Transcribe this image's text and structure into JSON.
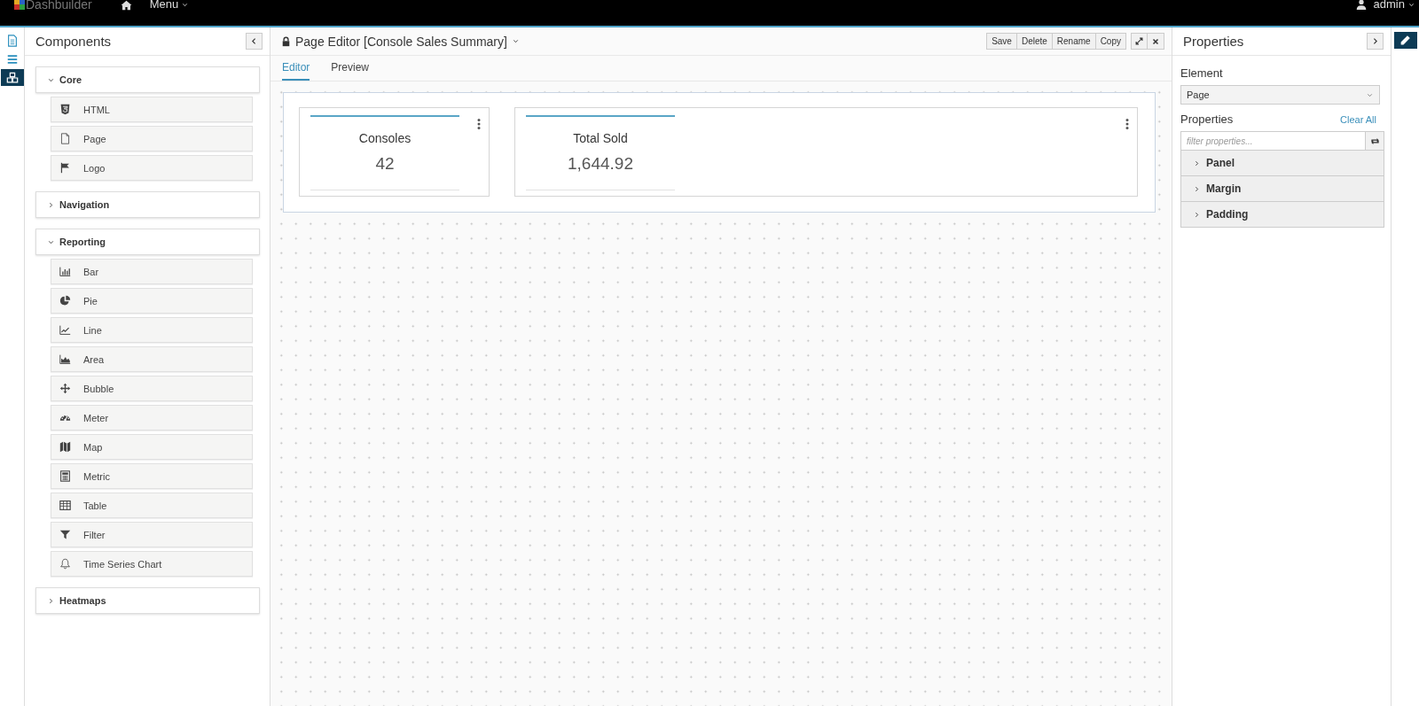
{
  "topbar": {
    "brand": "Dashbuilder",
    "menu": "Menu",
    "user": "admin"
  },
  "sidebar_icons": [
    {
      "selected": false
    },
    {
      "selected": false
    },
    {
      "selected": true
    }
  ],
  "components": {
    "title": "Components",
    "groups": [
      {
        "label": "Core",
        "expanded": true,
        "items": [
          "HTML",
          "Page",
          "Logo"
        ]
      },
      {
        "label": "Navigation",
        "expanded": false
      },
      {
        "label": "Reporting",
        "expanded": true,
        "items": [
          "Bar",
          "Pie",
          "Line",
          "Area",
          "Bubble",
          "Meter",
          "Map",
          "Metric",
          "Table",
          "Filter",
          "Time Series Chart"
        ]
      },
      {
        "label": "Heatmaps",
        "expanded": false
      }
    ]
  },
  "editor": {
    "title": "Page Editor [Console Sales Summary]",
    "buttons": [
      "Save",
      "Delete",
      "Rename",
      "Copy"
    ],
    "tabs": [
      {
        "label": "Editor",
        "selected": true
      },
      {
        "label": "Preview",
        "selected": false
      }
    ],
    "metrics": [
      {
        "title": "Consoles",
        "value": "42"
      },
      {
        "title": "Total Sold",
        "value": "1,644.92"
      }
    ]
  },
  "properties": {
    "title": "Properties",
    "element_label": "Element",
    "element_value": "Page",
    "properties_label": "Properties",
    "clear_all": "Clear All",
    "filter_placeholder": "filter properties...",
    "sections": [
      {
        "label": "Panel",
        "expanded": false
      },
      {
        "label": "Margin",
        "expanded": false
      },
      {
        "label": "Padding",
        "expanded": false
      }
    ]
  },
  "right_strip": [
    {
      "selected": true
    }
  ]
}
